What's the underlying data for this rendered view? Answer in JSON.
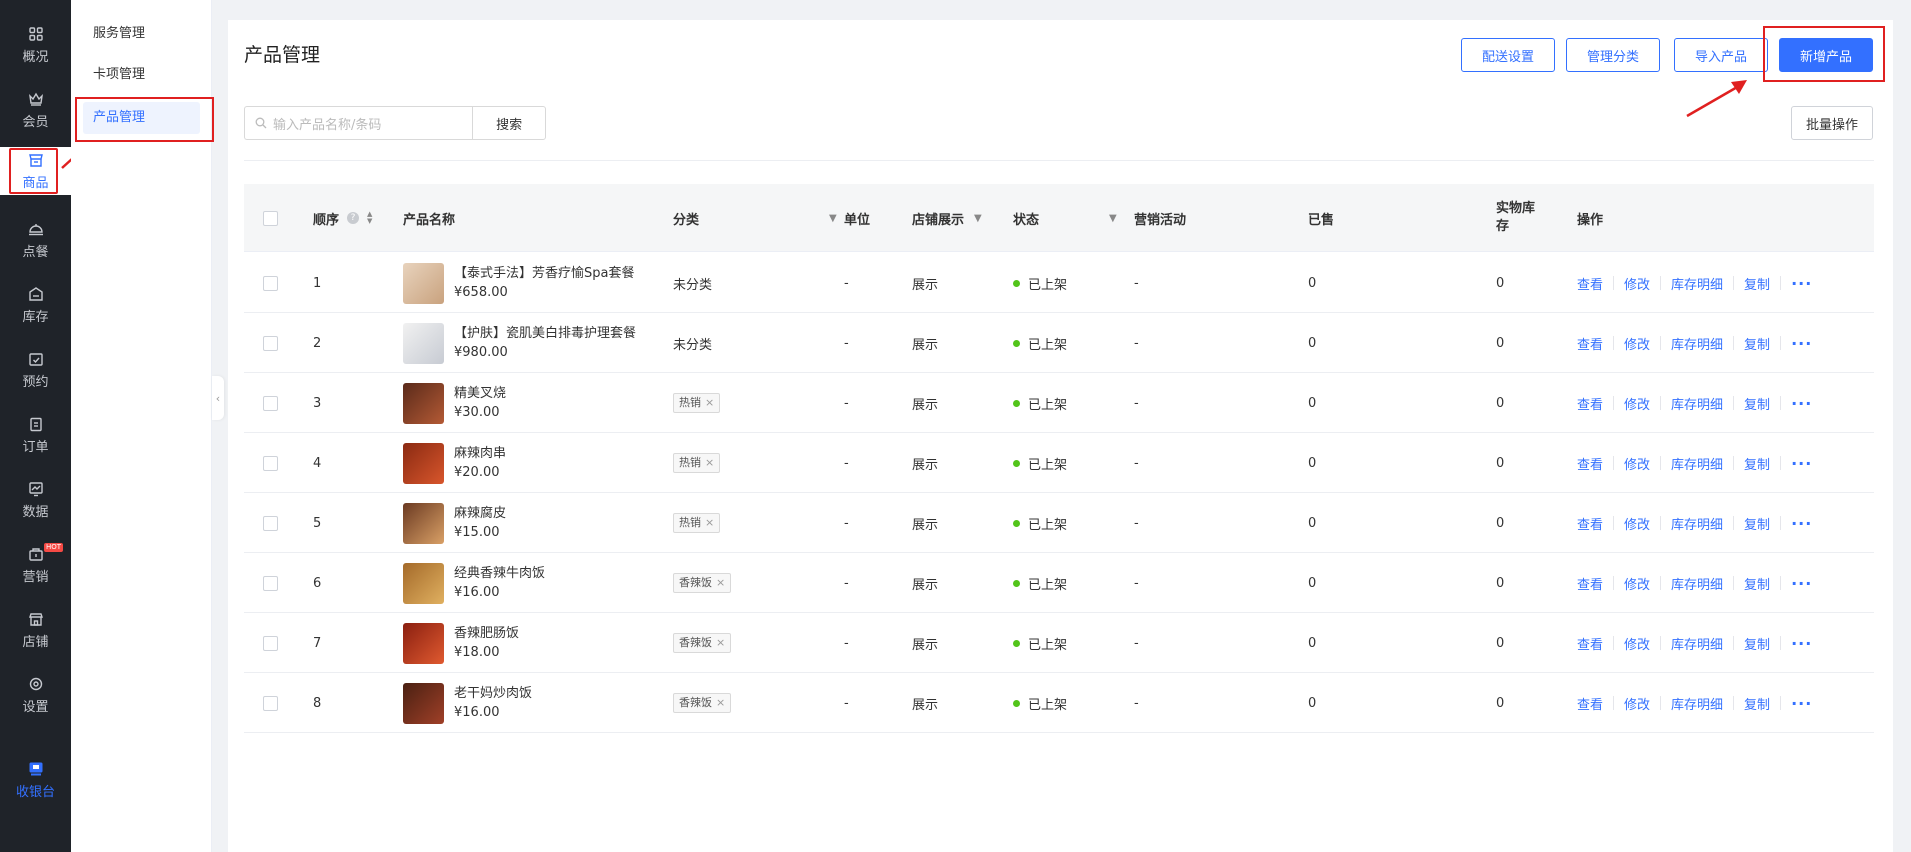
{
  "leftnav": {
    "items": [
      {
        "label": "概况",
        "icon": "grid-icon"
      },
      {
        "label": "会员",
        "icon": "crown-icon"
      },
      {
        "label": "商品",
        "icon": "shop-icon"
      },
      {
        "label": "点餐",
        "icon": "dish-icon"
      },
      {
        "label": "库存",
        "icon": "inventory-icon"
      },
      {
        "label": "预约",
        "icon": "calendar-icon"
      },
      {
        "label": "订单",
        "icon": "clipboard-icon"
      },
      {
        "label": "数据",
        "icon": "chart-icon"
      },
      {
        "label": "营销",
        "icon": "marketing-icon",
        "badge": "HOT"
      },
      {
        "label": "店铺",
        "icon": "store-icon"
      },
      {
        "label": "设置",
        "icon": "gear-icon"
      }
    ],
    "cashier": {
      "label": "收银台",
      "icon": "cashier-icon"
    }
  },
  "subnav": {
    "items": [
      "服务管理",
      "卡项管理",
      "产品管理"
    ]
  },
  "page": {
    "title": "产品管理",
    "buttons": {
      "delivery": "配送设置",
      "category": "管理分类",
      "import": "导入产品",
      "add": "新增产品",
      "batch": "批量操作"
    },
    "search": {
      "placeholder": "输入产品名称/条码",
      "button": "搜索"
    }
  },
  "table": {
    "headers": {
      "order": "顺序",
      "name": "产品名称",
      "category": "分类",
      "unit": "单位",
      "display": "店铺展示",
      "status": "状态",
      "promo": "营销活动",
      "sold": "已售",
      "stock": "实物库存",
      "actions": "操作"
    },
    "actions": [
      "查看",
      "修改",
      "库存明细",
      "复制"
    ],
    "rows": [
      {
        "order": "1",
        "name": "【泰式手法】芳香疗愉Spa套餐",
        "price": "¥658.00",
        "category": "未分类",
        "tag": false,
        "unit": "-",
        "display": "展示",
        "status": "已上架",
        "promo": "-",
        "sold": "0",
        "stock": "0"
      },
      {
        "order": "2",
        "name": "【护肤】瓷肌美白排毒护理套餐",
        "price": "¥980.00",
        "category": "未分类",
        "tag": false,
        "unit": "-",
        "display": "展示",
        "status": "已上架",
        "promo": "-",
        "sold": "0",
        "stock": "0"
      },
      {
        "order": "3",
        "name": "精美叉烧",
        "price": "¥30.00",
        "category": "热销",
        "tag": true,
        "unit": "-",
        "display": "展示",
        "status": "已上架",
        "promo": "-",
        "sold": "0",
        "stock": "0"
      },
      {
        "order": "4",
        "name": "麻辣肉串",
        "price": "¥20.00",
        "category": "热销",
        "tag": true,
        "unit": "-",
        "display": "展示",
        "status": "已上架",
        "promo": "-",
        "sold": "0",
        "stock": "0"
      },
      {
        "order": "5",
        "name": "麻辣腐皮",
        "price": "¥15.00",
        "category": "热销",
        "tag": true,
        "unit": "-",
        "display": "展示",
        "status": "已上架",
        "promo": "-",
        "sold": "0",
        "stock": "0"
      },
      {
        "order": "6",
        "name": "经典香辣牛肉饭",
        "price": "¥16.00",
        "category": "香辣饭",
        "tag": true,
        "unit": "-",
        "display": "展示",
        "status": "已上架",
        "promo": "-",
        "sold": "0",
        "stock": "0"
      },
      {
        "order": "7",
        "name": "香辣肥肠饭",
        "price": "¥18.00",
        "category": "香辣饭",
        "tag": true,
        "unit": "-",
        "display": "展示",
        "status": "已上架",
        "promo": "-",
        "sold": "0",
        "stock": "0"
      },
      {
        "order": "8",
        "name": "老干妈炒肉饭",
        "price": "¥16.00",
        "category": "香辣饭",
        "tag": true,
        "unit": "-",
        "display": "展示",
        "status": "已上架",
        "promo": "-",
        "sold": "0",
        "stock": "0"
      }
    ]
  },
  "colors": {
    "accent": "#3370ff",
    "sidebar_bg": "#1f2329",
    "highlight": "#e02020",
    "status_on": "#52c41a"
  }
}
